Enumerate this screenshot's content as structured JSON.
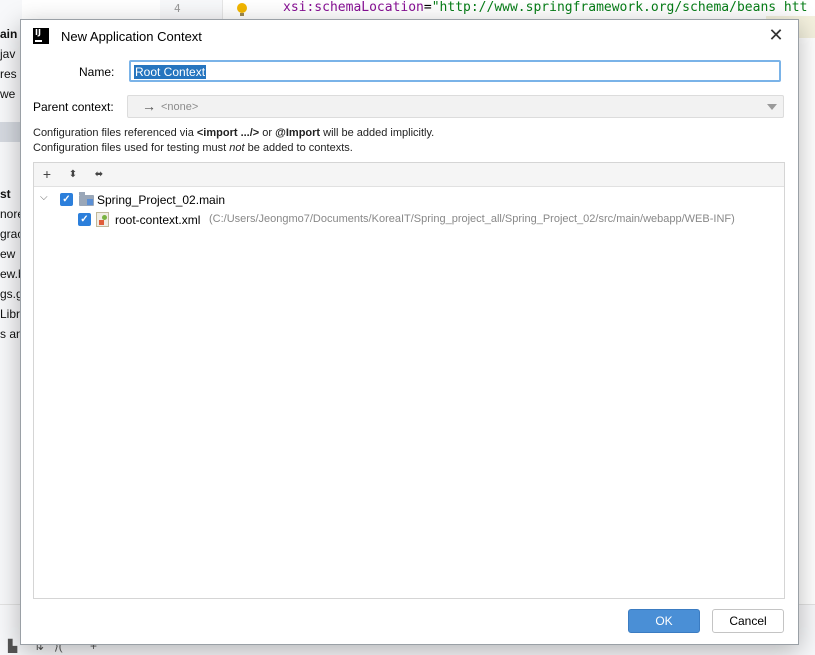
{
  "background": {
    "left_items": [
      "ain",
      "jav",
      "res",
      "we",
      "st",
      "nore",
      "grac",
      "ew",
      "ew.b",
      "gs.g",
      "Libra",
      "s an"
    ],
    "line_number": "4",
    "code_attr": "xsi:schemaLocation",
    "code_eq": "=",
    "code_value": "\"http://www.springframework.org/schema/beans htt"
  },
  "dialog": {
    "title": "New Application Context",
    "name_label": "Name:",
    "name_value": "Root Context",
    "parent_label": "Parent context:",
    "parent_value": "<none>",
    "info1_a": "Configuration files referenced via ",
    "info1_b": "<import .../>",
    "info1_c": " or ",
    "info1_d": "@Import",
    "info1_e": " will be added implicitly.",
    "info2_a": "Configuration files used for testing must ",
    "info2_b": "not",
    "info2_c": " be added to contexts.",
    "toolbar": {
      "add": "+",
      "expand": "⬍",
      "collapse": "⬌"
    },
    "tree": {
      "module": "Spring_Project_02.main",
      "file": "root-context.xml",
      "file_path": "(C:/Users/Jeongmo7/Documents/KoreaIT/Spring_project_all/Spring_Project_02/src/main/webapp/WEB-INF)"
    },
    "ok_label": "OK",
    "cancel_label": "Cancel"
  }
}
